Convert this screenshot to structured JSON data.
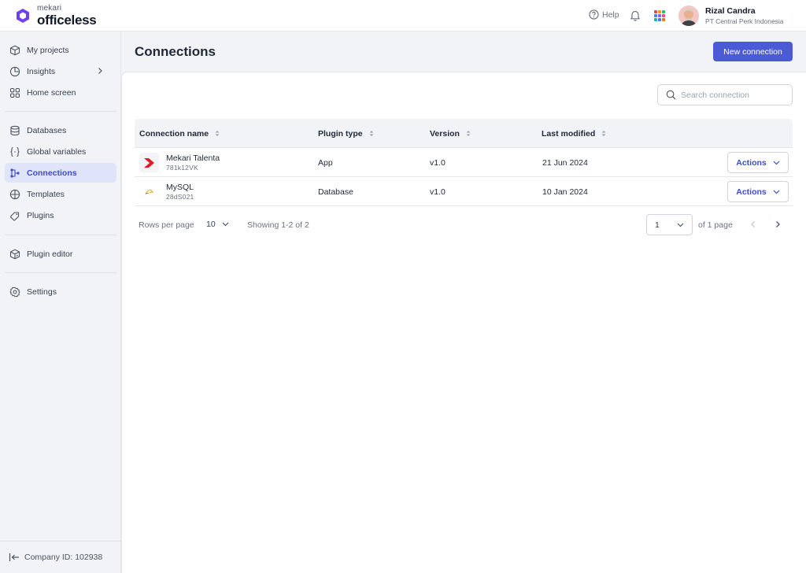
{
  "brand": {
    "company": "mekari",
    "product": "officeless",
    "accent": "#4b5bd6",
    "logo_color": "#6d3ff0"
  },
  "topbar": {
    "help_label": "Help",
    "user_name": "Rizal Candra",
    "user_company": "PT Central Perk Indonesia"
  },
  "sidebar": {
    "items": [
      {
        "label": "My projects",
        "icon": "cube-icon"
      },
      {
        "label": "Insights",
        "icon": "pie-chart-icon"
      },
      {
        "label": "Home screen",
        "icon": "grid-squares-icon"
      },
      {
        "label": "Databases",
        "icon": "database-icon"
      },
      {
        "label": "Global variables",
        "icon": "braces-icon"
      },
      {
        "label": "Connections",
        "icon": "connections-icon",
        "active": true
      },
      {
        "label": "Templates",
        "icon": "template-icon"
      },
      {
        "label": "Plugins",
        "icon": "plug-icon"
      },
      {
        "label": "Plugin editor",
        "icon": "cube-edit-icon"
      },
      {
        "label": "Settings",
        "icon": "gear-icon"
      }
    ],
    "company_id": "Company ID: 102938"
  },
  "page": {
    "title": "Connections",
    "new_button": "New connection",
    "search_placeholder": "Search connection"
  },
  "table": {
    "columns": [
      "Connection name",
      "Plugin type",
      "Version",
      "Last modified"
    ],
    "rows": [
      {
        "name": "Mekari Talenta",
        "id": "781k12VK",
        "type": "App",
        "version": "v1.0",
        "modified": "21 Jun 2024",
        "action": "Actions"
      },
      {
        "name": "MySQL",
        "id": "28dS021",
        "type": "Database",
        "version": "v1.0",
        "modified": "10 Jan 2024",
        "action": "Actions"
      }
    ]
  },
  "pagination": {
    "rows_per_page_label": "Rows per page",
    "rows_per_page": "10",
    "showing": "Showing 1-2 of 2",
    "page": "1",
    "of_pages": "of 1 page"
  }
}
